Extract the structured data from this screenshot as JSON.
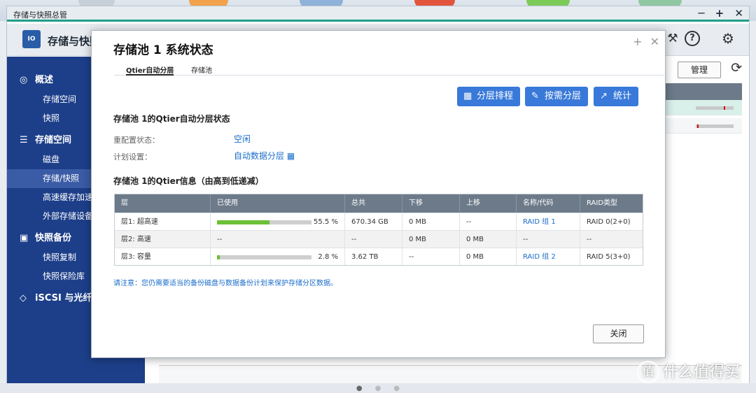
{
  "app": {
    "title": "存储与快照总管",
    "name": "存储与快照总管",
    "window_controls": [
      "─",
      "+",
      "✕"
    ],
    "logo_text": "IO"
  },
  "sidebar": {
    "sections": [
      {
        "label": "概述",
        "icon": "speedometer-icon",
        "items": [
          "存储空间",
          "快照"
        ]
      },
      {
        "label": "存储空间",
        "icon": "database-icon",
        "items": [
          "磁盘",
          "存储/快照",
          "高速缓存加速",
          "外部存储设备"
        ]
      },
      {
        "label": "快照备份",
        "icon": "snapshot-backup-icon",
        "items": [
          "快照复制",
          "快照保险库"
        ]
      },
      {
        "label": "iSCSI 与光纤通道",
        "icon": "iscsi-icon",
        "items": []
      }
    ],
    "active_item": "存储/快照"
  },
  "content": {
    "manage_label": "管理"
  },
  "modal": {
    "title": "存储池 1 系统状态",
    "tabs": [
      {
        "label": "Qtier自动分层",
        "active": true
      },
      {
        "label": "存储池",
        "active": false
      }
    ],
    "actions": [
      {
        "label": "分层排程",
        "icon": "calendar-icon"
      },
      {
        "label": "按需分层",
        "icon": "edit-icon"
      },
      {
        "label": "统计",
        "icon": "chart-icon"
      }
    ],
    "status_title": "存储池 1的Qtier自动分层状态",
    "reconfig_label": "重配置状态：",
    "reconfig_value": "空闲",
    "schedule_label": "计划设置：",
    "schedule_value": "自动数据分层",
    "info_title": "存储池 1的Qtier信息（由高到低递减）",
    "table": {
      "headers": [
        "层",
        "已使用",
        "总共",
        "下移",
        "上移",
        "名称/代码",
        "RAID类型"
      ],
      "rows": [
        {
          "tier": "层1: 超高速",
          "used_pct": 55.5,
          "used_text": "55.5 %",
          "total": "670.34 GB",
          "down": "0 MB",
          "up": "--",
          "name": "RAID 组 1",
          "raid": "RAID 0(2+0)"
        },
        {
          "tier": "层2: 高速",
          "used_pct": null,
          "used_text": "--",
          "total": "--",
          "down": "0 MB",
          "up": "0 MB",
          "name": "--",
          "raid": "--"
        },
        {
          "tier": "层3: 容量",
          "used_pct": 2.8,
          "used_text": "2.8 %",
          "total": "3.62 TB",
          "down": "--",
          "up": "0 MB",
          "name": "RAID 组 2",
          "raid": "RAID 5(3+0)"
        }
      ]
    },
    "note": "请注意：您仍需要适当的备份磁盘与数据备份计划来保护存储分区数据。",
    "close_label": "关闭",
    "controls": [
      "+",
      "✕"
    ]
  },
  "watermark": {
    "text": "什么值得买",
    "mark": "值"
  },
  "colors": {
    "sidebar_bg": "#1d3f8a",
    "accent_button": "#3879d9",
    "usage_bar": "#6cc136",
    "link": "#1a6dc9",
    "table_header": "#6c7a89",
    "title_accent": "#1f9f88"
  }
}
